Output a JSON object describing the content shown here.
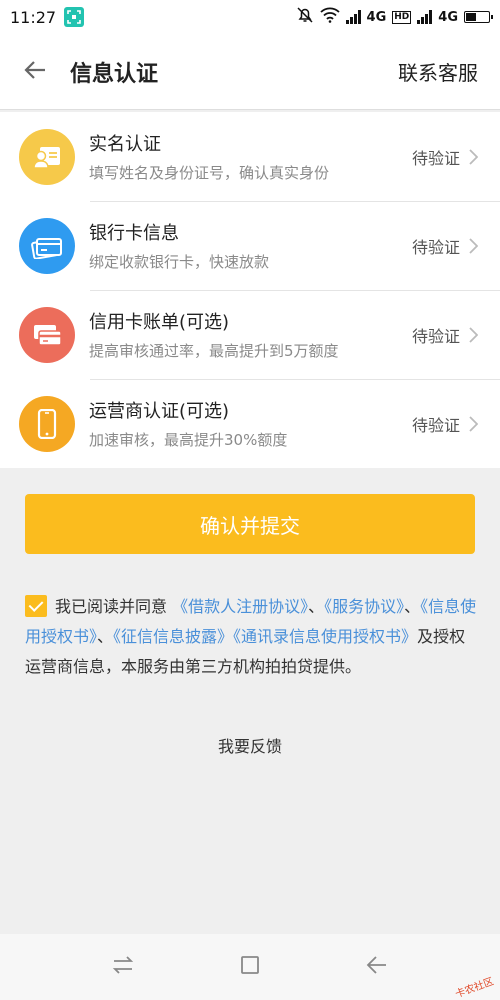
{
  "status_bar": {
    "time": "11:27",
    "network1": "4G",
    "hd": "HD",
    "network2": "4G"
  },
  "header": {
    "title": "信息认证",
    "service_link": "联系客服"
  },
  "items": [
    {
      "title": "实名认证",
      "desc": "填写姓名及身份证号，确认真实身份",
      "status": "待验证",
      "icon": "id-card-icon",
      "color": "#f6c94a"
    },
    {
      "title": "银行卡信息",
      "desc": "绑定收款银行卡，快速放款",
      "status": "待验证",
      "icon": "bank-card-icon",
      "color": "#2f9bf0"
    },
    {
      "title": "信用卡账单(可选)",
      "desc": "提高审核通过率，最高提升到5万额度",
      "status": "待验证",
      "icon": "credit-card-icon",
      "color": "#ec6d5b"
    },
    {
      "title": "运营商认证(可选)",
      "desc": "加速审核，最高提升30%额度",
      "status": "待验证",
      "icon": "phone-icon",
      "color": "#f5a823"
    }
  ],
  "submit": {
    "label": "确认并提交",
    "color": "#fbbc1e"
  },
  "agreement": {
    "prefix": "我已阅读并同意",
    "link1": "《借款人注册协议》",
    "sep1": "、",
    "link2": "《服务协议》",
    "sep2": "、",
    "link3": "《信息使用授权书》",
    "sep3": "、",
    "link4": "《征信信息披露》",
    "link5": "《通讯录信息使用授权书》",
    "suffix": "及授权运营商信息，本服务由第三方机构拍拍贷提供。",
    "checked": true
  },
  "feedback": "我要反馈",
  "watermark": "卡农社区"
}
